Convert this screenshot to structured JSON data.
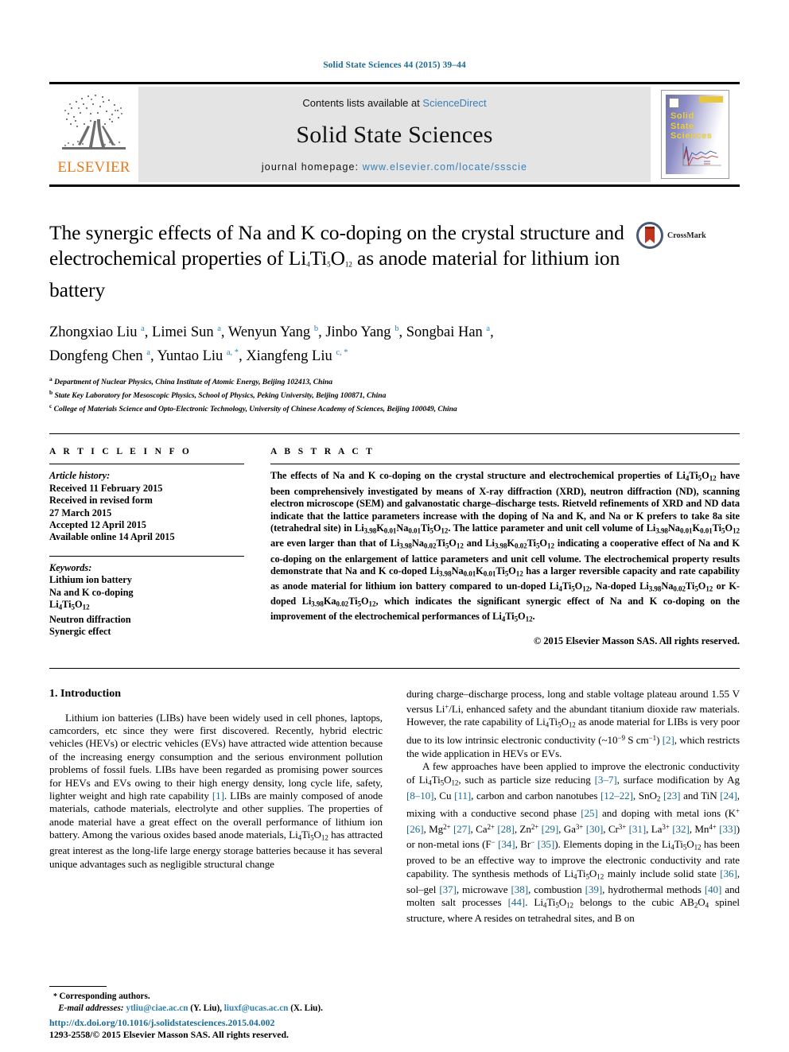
{
  "running_head": "Solid State Sciences 44 (2015) 39–44",
  "masthead": {
    "publisher_logo_text": "ELSEVIER",
    "contents_prefix": "Contents lists available at",
    "contents_link": "ScienceDirect",
    "journal_name": "Solid State Sciences",
    "homepage_prefix": "journal homepage:",
    "homepage_url": "www.elsevier.com/locate/ssscie",
    "cover_title_lines": [
      "Solid",
      "State",
      "Sciences"
    ]
  },
  "article": {
    "title": "The synergic effects of Na and K co-doping on the crystal structure and electrochemical properties of Li4Ti5O12 as anode material for lithium ion battery",
    "crossmark_label": "CrossMark",
    "authors_line_1": "Zhongxiao Liu a, Limei Sun a, Wenyun Yang b, Jinbo Yang b, Songbai Han a,",
    "authors_line_2": "Dongfeng Chen a, Yuntao Liu a, *, Xiangfeng Liu c, *",
    "affiliations": [
      {
        "mark": "a",
        "text": "Department of Nuclear Physics, China Institute of Atomic Energy, Beijing 102413, China"
      },
      {
        "mark": "b",
        "text": "State Key Laboratory for Mesoscopic Physics, School of Physics, Peking University, Beijing 100871, China"
      },
      {
        "mark": "c",
        "text": "College of Materials Science and Opto-Electronic Technology, University of Chinese Academy of Sciences, Beijing 100049, China"
      }
    ]
  },
  "article_info": {
    "label": "A R T I C L E  I N F O",
    "history_label": "Article history:",
    "history": [
      "Received 11 February 2015",
      "Received in revised form",
      "27 March 2015",
      "Accepted 12 April 2015",
      "Available online 14 April 2015"
    ],
    "keywords_label": "Keywords:",
    "keywords": [
      "Lithium ion battery",
      "Na and K co-doping",
      "Li4Ti5O12",
      "Neutron diffraction",
      "Synergic effect"
    ]
  },
  "abstract": {
    "label": "A B S T R A C T",
    "copyright": "© 2015 Elsevier Masson SAS. All rights reserved."
  },
  "introduction": {
    "heading": "1.  Introduction"
  },
  "footnotes": {
    "corresponding": "Corresponding authors.",
    "email_label": "E-mail addresses:",
    "email_1": "ytliu@ciae.ac.cn",
    "email_1_name": "(Y. Liu),",
    "email_2": "liuxf@ucas.ac.cn",
    "email_2_name": "(X. Liu).",
    "doi": "http://dx.doi.org/10.1016/j.solidstatesciences.2015.04.002",
    "issn_line": "1293-2558/© 2015 Elsevier Masson SAS. All rights reserved."
  },
  "colors": {
    "link_blue": "#2f80b0",
    "ref_blue": "#1a6a93",
    "elsevier_orange": "#E87A1E",
    "masthead_grey": "#e4e4e4",
    "cover_yellow": "#f0d23c"
  }
}
